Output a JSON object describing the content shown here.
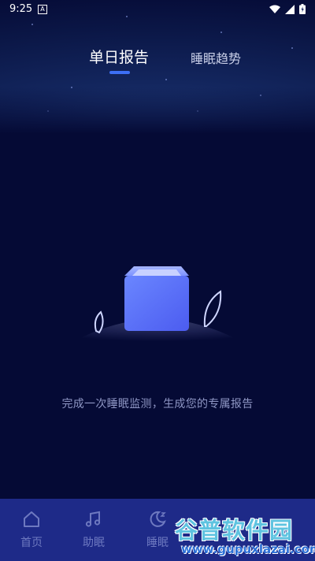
{
  "status_bar": {
    "time": "9:25",
    "app_icon_letter": "A"
  },
  "tabs": [
    {
      "label": "单日报告",
      "active": true
    },
    {
      "label": "睡眠趋势",
      "active": false
    }
  ],
  "empty_state": {
    "message": "完成一次睡眠监测，生成您的专属报告"
  },
  "bottom_nav": {
    "items": [
      {
        "label": "首页",
        "icon": "home-icon"
      },
      {
        "label": "助眠",
        "icon": "music-note-icon"
      },
      {
        "label": "睡眠",
        "icon": "moon-icon"
      }
    ]
  },
  "watermark": {
    "title": "谷普软件园",
    "url": "www.gupuxlazai.com"
  },
  "colors": {
    "background": "#050a35",
    "accent": "#3d6ff5",
    "nav_bg": "#1e2a88",
    "muted_text": "#8e96c4"
  }
}
